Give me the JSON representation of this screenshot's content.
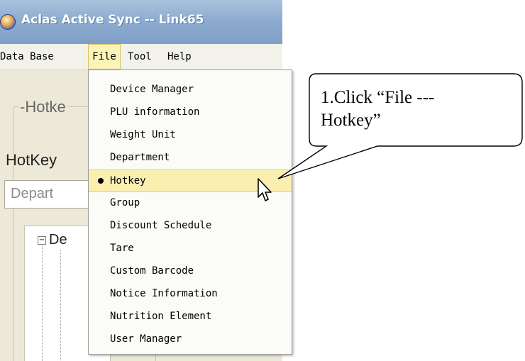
{
  "window": {
    "title": "Aclas Active Sync -- Link65"
  },
  "menubar": {
    "items": [
      "Data Base",
      "File",
      "Tool",
      "Help"
    ],
    "active_item": "File"
  },
  "background_panel": {
    "group_legend": "-Hotke",
    "hotkey_label": "HotKey",
    "department_combo_value": "Depart",
    "tree_root": "De"
  },
  "file_menu": {
    "items": [
      "Device Manager",
      "PLU information",
      "Weight Unit",
      "Department",
      "Hotkey",
      "Group",
      "Discount Schedule",
      "Tare",
      "Custom Barcode",
      "Notice Information",
      "Nutrition Element",
      "User Manager"
    ],
    "selected_item": "Hotkey"
  },
  "annotation": {
    "callout_line1": "1.Click “File ---",
    "callout_line2": "Hotkey”"
  },
  "colors": {
    "titlebar": "#8eacd0",
    "menu_highlight": "#fbefb0",
    "window_background": "#ece9d8"
  },
  "icons": {
    "app": "app-icon",
    "cursor": "mouse-pointer-icon",
    "selected_marker": "radio-bullet-icon"
  }
}
